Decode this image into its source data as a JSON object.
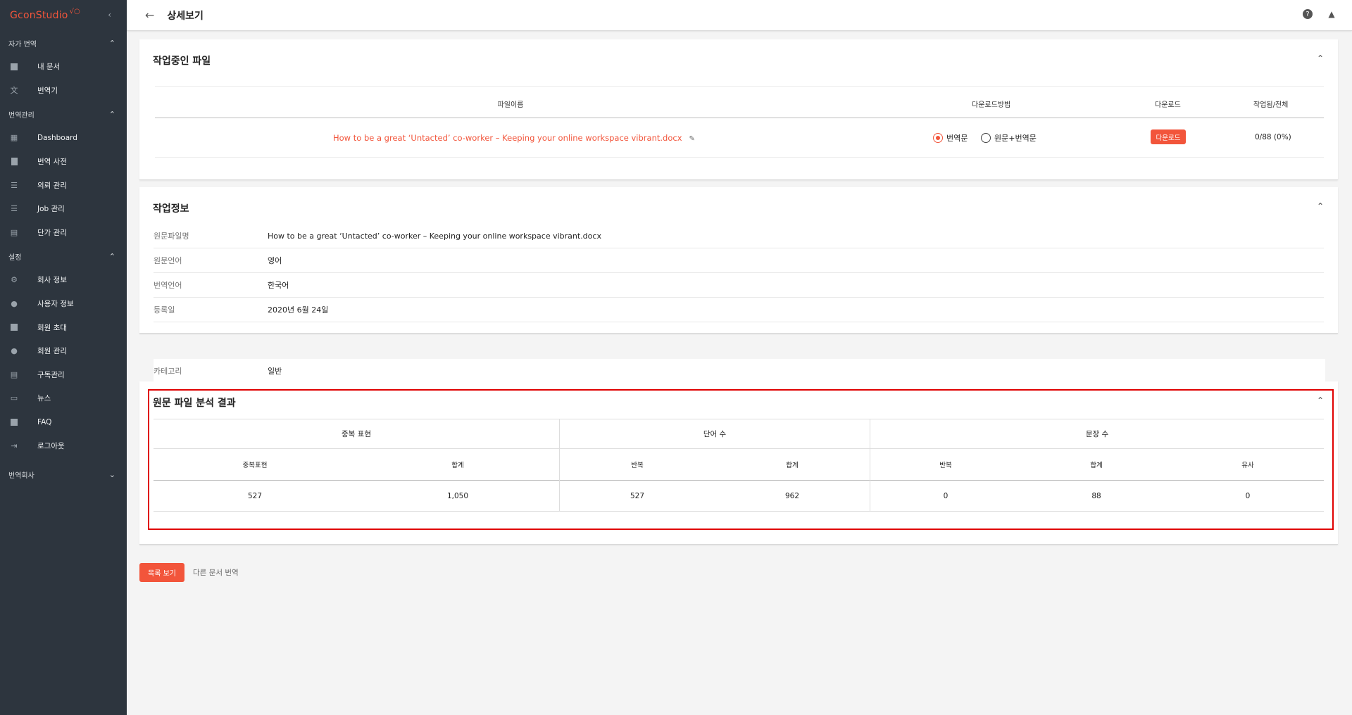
{
  "brand": {
    "name": "GconStudio",
    "mark": "√○"
  },
  "sidebar": {
    "sections": [
      {
        "title": "자가 번역",
        "items": [
          "내 문서",
          "번역기"
        ]
      },
      {
        "title": "번역관리",
        "items": [
          "Dashboard",
          "번역 사전",
          "의뢰 관리",
          "Job 관리",
          "단가 관리"
        ]
      },
      {
        "title": "설정",
        "items": [
          "회사 정보",
          "사용자 정보",
          "회원 초대",
          "회원 관리",
          "구독관리",
          "뉴스",
          "FAQ",
          "로그아웃"
        ]
      },
      {
        "title": "번역회사",
        "items": []
      }
    ]
  },
  "header": {
    "title": "상세보기"
  },
  "working_files": {
    "title": "작업중인 파일",
    "columns": {
      "filename": "파일이름",
      "method": "다운로드방법",
      "download": "다운로드",
      "progress": "작업됨/전체"
    },
    "row": {
      "filename": "How to be a great ‘Untacted’ co-worker – Keeping your online workspace vibrant.docx",
      "option_translation": "번역문",
      "option_both": "원문+번역문",
      "selected": "번역문",
      "download_label": "다운로드",
      "progress": "0/88 (0%)"
    }
  },
  "job_info": {
    "title": "작업정보",
    "rows": [
      {
        "label": "원문파일명",
        "value": "How to be a great ‘Untacted’ co-worker – Keeping your online workspace vibrant.docx"
      },
      {
        "label": "원문언어",
        "value": "영어"
      },
      {
        "label": "번역언어",
        "value": "한국어"
      },
      {
        "label": "등록일",
        "value": "2020년 6월 24일"
      },
      {
        "label": "카테고리",
        "value": "일반"
      }
    ]
  },
  "analysis": {
    "title": "원문 파일 분석 결과",
    "groups": {
      "duplicate": "중복 표현",
      "words": "단어 수",
      "sentences": "문장 수"
    },
    "subheads": {
      "dup_expr": "중복표현",
      "dup_total": "합계",
      "word_repeat": "반복",
      "word_total": "합계",
      "sent_repeat": "반복",
      "sent_total": "합계",
      "sent_similar": "유사"
    },
    "values": {
      "dup_expr": "527",
      "dup_total": "1,050",
      "word_repeat": "527",
      "word_total": "962",
      "sent_repeat": "0",
      "sent_total": "88",
      "sent_similar": "0"
    }
  },
  "footer": {
    "list_button": "목록 보기",
    "other_doc_link": "다른 문서 번역"
  },
  "colors": {
    "accent": "#f2553b",
    "sidebar_bg": "#2d353e",
    "highlight": "#e00000"
  }
}
